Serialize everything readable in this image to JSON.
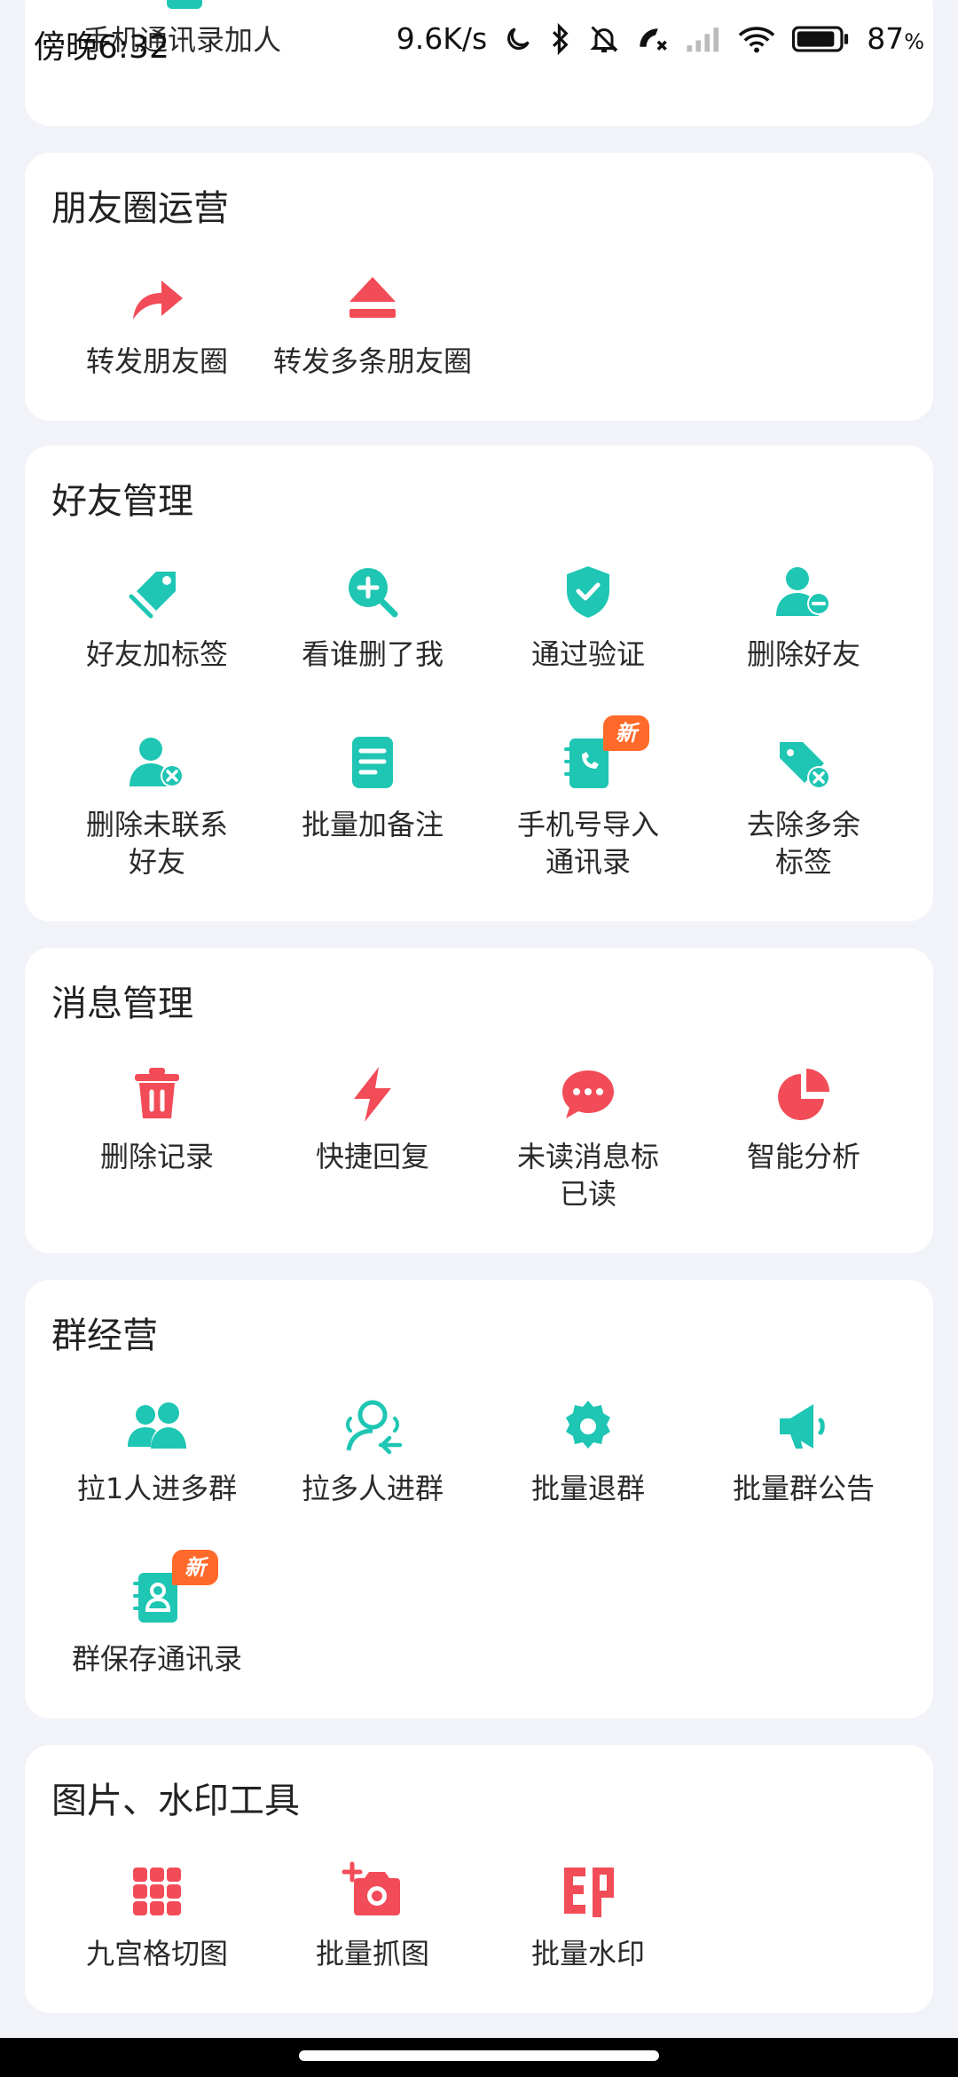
{
  "status": {
    "time": "傍晚6:32",
    "speed": "9.6K/s",
    "battery": "87",
    "battery_unit": "%"
  },
  "top_card": {
    "label": "手机通讯录加人"
  },
  "sections": [
    {
      "title": "朋友圈运营",
      "items": [
        {
          "label": "转发朋友圈",
          "icon": "share-arrow-icon",
          "color": "#f24c58"
        },
        {
          "label": "转发多条朋友圈",
          "icon": "eject-icon",
          "color": "#f24c58"
        }
      ]
    },
    {
      "title": "好友管理",
      "items": [
        {
          "label": "好友加标签",
          "icon": "tags-icon",
          "color": "#1ec6b3"
        },
        {
          "label": "看谁删了我",
          "icon": "zoom-plus-icon",
          "color": "#1ec6b3"
        },
        {
          "label": "通过验证",
          "icon": "shield-check-icon",
          "color": "#1ec6b3"
        },
        {
          "label": "删除好友",
          "icon": "user-minus-icon",
          "color": "#1ec6b3"
        },
        {
          "label": "删除未联系\n好友",
          "icon": "user-x-icon",
          "color": "#1ec6b3"
        },
        {
          "label": "批量加备注",
          "icon": "note-icon",
          "color": "#1ec6b3"
        },
        {
          "label": "手机号导入\n通讯录",
          "icon": "phonebook-icon",
          "color": "#1ec6b3",
          "badge": "新"
        },
        {
          "label": "去除多余\n标签",
          "icon": "tag-x-icon",
          "color": "#1ec6b3"
        }
      ]
    },
    {
      "title": "消息管理",
      "items": [
        {
          "label": "删除记录",
          "icon": "trash-icon",
          "color": "#f24c58"
        },
        {
          "label": "快捷回复",
          "icon": "lightning-icon",
          "color": "#f24c58"
        },
        {
          "label": "未读消息标\n已读",
          "icon": "chat-bubble-icon",
          "color": "#f24c58"
        },
        {
          "label": "智能分析",
          "icon": "pie-chart-icon",
          "color": "#f24c58"
        }
      ]
    },
    {
      "title": "群经营",
      "items": [
        {
          "label": "拉1人进多群",
          "icon": "group-users-icon",
          "color": "#1ec6b3"
        },
        {
          "label": "拉多人进群",
          "icon": "user-arrow-icon",
          "color": "#1ec6b3"
        },
        {
          "label": "批量退群",
          "icon": "gear-icon",
          "color": "#1ec6b3"
        },
        {
          "label": "批量群公告",
          "icon": "megaphone-icon",
          "color": "#1ec6b3"
        },
        {
          "label": "群保存通讯录",
          "icon": "contact-book-icon",
          "color": "#1ec6b3",
          "badge": "新"
        }
      ]
    },
    {
      "title": "图片、水印工具",
      "items": [
        {
          "label": "九宫格切图",
          "icon": "grid-icon",
          "color": "#f24c58"
        },
        {
          "label": "批量抓图",
          "icon": "camera-plus-icon",
          "color": "#f24c58"
        },
        {
          "label": "批量水印",
          "icon": "stamp-icon",
          "color": "#f24c58"
        }
      ]
    }
  ]
}
